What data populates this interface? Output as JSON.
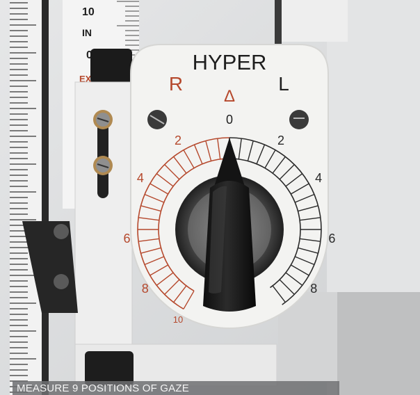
{
  "photo": {
    "left_scale": {
      "labels": [
        "10",
        "IN",
        "0",
        "EX"
      ]
    },
    "dial": {
      "title": "HYPER",
      "side_left": "R",
      "side_right": "L",
      "delta_symbol": "Δ",
      "zero_label": "0",
      "left_numbers": [
        "2",
        "4",
        "6",
        "8",
        "10"
      ],
      "right_numbers": [
        "2",
        "4",
        "6",
        "8"
      ],
      "colors": {
        "left_scale": "#b5482c",
        "right_scale": "#2a2a2a",
        "plate": "#f3f3f1",
        "knob": "#1c1c1c"
      }
    }
  },
  "caption": {
    "text": "MEASURE 9 POSITIONS OF GAZE"
  }
}
